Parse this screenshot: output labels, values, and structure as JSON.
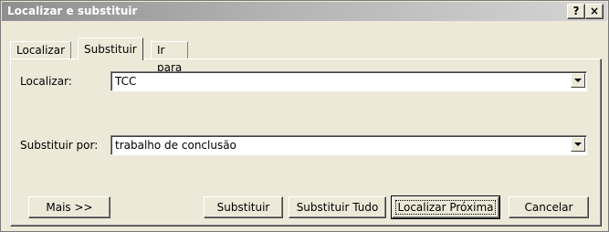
{
  "window": {
    "title": "Localizar e substituir",
    "help_label": "?",
    "close_label": "×"
  },
  "tabs": [
    {
      "label": "Localizar"
    },
    {
      "label": "Substituir"
    },
    {
      "label": "Ir para"
    }
  ],
  "find": {
    "label": "Localizar:",
    "value": "TCC"
  },
  "replace": {
    "label": "Substituir por:",
    "value": "trabalho de conclusão"
  },
  "buttons": {
    "more": "Mais >>",
    "replace": "Substituir",
    "replace_all": "Substituir Tudo",
    "find_next": "Localizar Próxima",
    "cancel": "Cancelar"
  }
}
